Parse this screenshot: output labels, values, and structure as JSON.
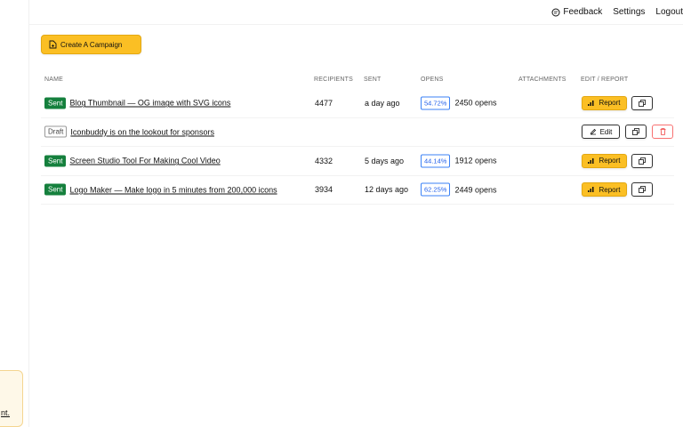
{
  "topnav": {
    "feedback": "Feedback",
    "settings": "Settings",
    "logout": "Logout"
  },
  "sidebar_card": {
    "link_text": "nt."
  },
  "create_button": {
    "label": "Create A Campaign"
  },
  "table": {
    "headers": {
      "name": "NAME",
      "recipients": "RECIPIENTS",
      "sent": "SENT",
      "opens": "OPENS",
      "attachments": "ATTACHMENTS",
      "actions": "EDIT / REPORT"
    },
    "rows": [
      {
        "status": "Sent",
        "name": "Blog Thumbnail — OG image with SVG icons",
        "recipients": "4477",
        "sent": "a day ago",
        "open_rate": "54.72%",
        "opens": "2450 opens",
        "report": "Report"
      },
      {
        "status": "Draft",
        "name": "Iconbuddy is on the lookout for sponsors",
        "edit": "Edit"
      },
      {
        "status": "Sent",
        "name": "Screen Studio Tool For Making Cool Video",
        "recipients": "4332",
        "sent": "5 days ago",
        "open_rate": "44.14%",
        "opens": "1912 opens",
        "report": "Report"
      },
      {
        "status": "Sent",
        "name": "Logo Maker — Make logo in 5 minutes from 200,000 icons",
        "recipients": "3934",
        "sent": "12 days ago",
        "open_rate": "62.25%",
        "opens": "2449 opens",
        "report": "Report"
      }
    ]
  },
  "colors": {
    "accent": "#fbbf24",
    "sent_badge": "#15803d",
    "open_rate": "#2563eb",
    "delete": "#f87171"
  }
}
